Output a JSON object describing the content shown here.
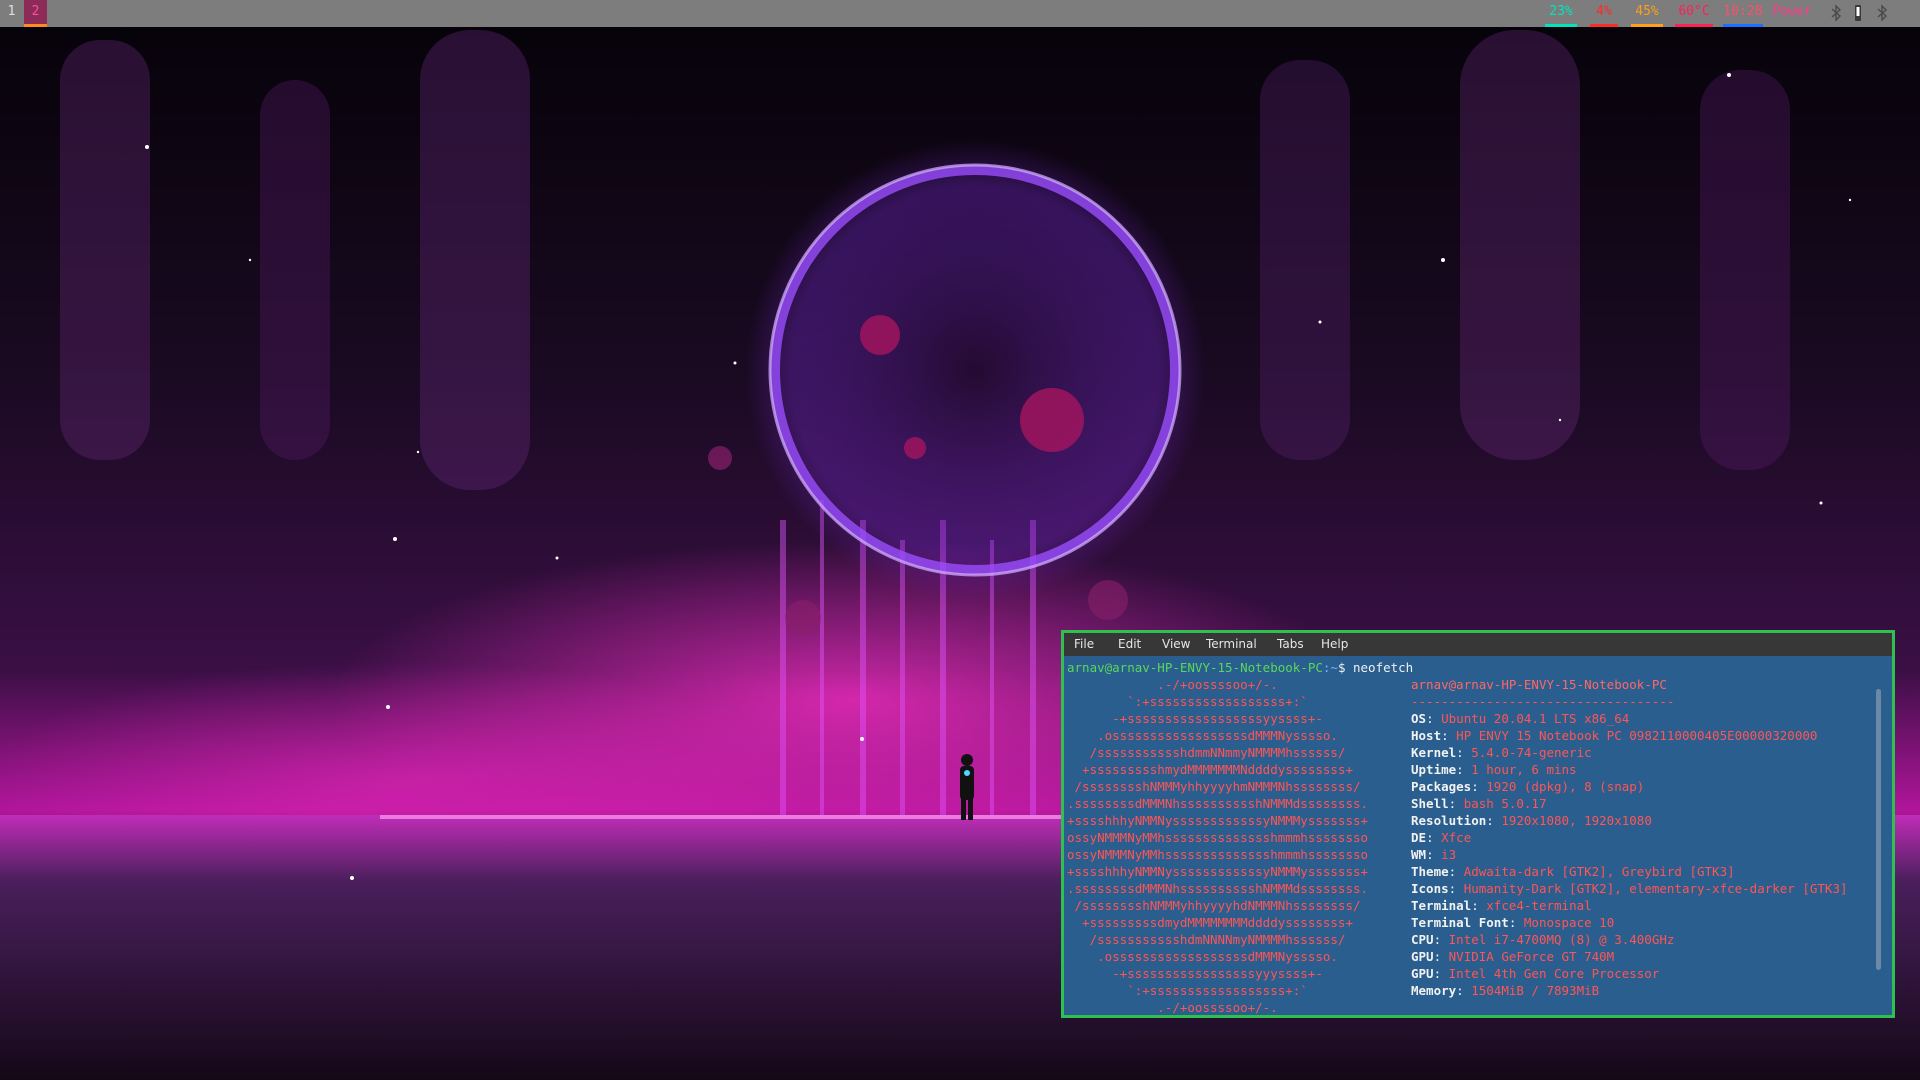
{
  "colors": {
    "topbar_bg": "#7d7d7d",
    "cpu": "#00e5c0",
    "memory": "#ff2a2a",
    "battery": "#ff9f1a",
    "temperature": "#ff1f5a",
    "clock": "#1e6fff",
    "power": "#ff3b8a",
    "terminal_border": "#2fc14f",
    "terminal_bg": "#2a5e8f",
    "terminal_menubar": "#373737"
  },
  "topbar": {
    "workspaces": [
      "1",
      "2"
    ],
    "active_workspace": "2",
    "stats": {
      "cpu": "23%",
      "memory": "4%",
      "battery": "45%",
      "temperature": "60°C",
      "clock": "10:28",
      "power": "Power"
    },
    "tray_icons": [
      "bluetooth-icon",
      "usb-icon",
      "bluetooth-icon"
    ]
  },
  "terminal": {
    "menu": [
      "File",
      "Edit",
      "View",
      "Terminal",
      "Tabs",
      "Help"
    ],
    "prompt_user_host": "arnav@arnav-HP-ENVY-15-Notebook-PC",
    "prompt_path": ":~",
    "prompt_symbol": "$",
    "command": "neofetch",
    "logo_lines": [
      "            .-/+oossssoo+/-.",
      "        `:+ssssssssssssssssss+:`",
      "      -+ssssssssssssssssssyyssss+-",
      "    .ossssssssssssssssssdMMMNysssso.",
      "   /ssssssssssshdmmNNmmyNMMMMhssssss/",
      "  +ssssssssshmydMMMMMMMNddddyssssssss+",
      " /sssssssshNMMMyhhyyyyhmNMMMNhssssssss/",
      ".ssssssssdMMMNhsssssssssshNMMMdssssssss.",
      "+sssshhhyNMMNyssssssssssssyNMMMysssssss+",
      "ossyNMMMNyMMhsssssssssssssshmmmhssssssso",
      "ossyNMMMNyMMhsssssssssssssshmmmhssssssso",
      "+sssshhhyNMMNyssssssssssssyNMMMysssssss+",
      ".ssssssssdMMMNhsssssssssshNMMMdssssssss.",
      " /sssssssshNMMMyhhyyyyhdNMMMNhssssssss/",
      "  +sssssssssdmydMMMMMMMMddddyssssssss+",
      "   /ssssssssssshdmNNNNmyNMMMMhssssss/",
      "    .ossssssssssssssssssdMMMNysssso.",
      "      -+sssssssssssssssssyyyssss+-",
      "        `:+ssssssssssssssssss+:`",
      "            .-/+oossssoo+/-."
    ],
    "title_user": "arnav",
    "title_at": "@",
    "title_host": "arnav-HP-ENVY-15-Notebook-PC",
    "separator": "-----------------------------------",
    "info": [
      {
        "key": "OS",
        "value": "Ubuntu 20.04.1 LTS x86_64"
      },
      {
        "key": "Host",
        "value": "HP ENVY 15 Notebook PC 0982110000405E00000320000"
      },
      {
        "key": "Kernel",
        "value": "5.4.0-74-generic"
      },
      {
        "key": "Uptime",
        "value": "1 hour, 6 mins"
      },
      {
        "key": "Packages",
        "value": "1920 (dpkg), 8 (snap)"
      },
      {
        "key": "Shell",
        "value": "bash 5.0.17"
      },
      {
        "key": "Resolution",
        "value": "1920x1080, 1920x1080"
      },
      {
        "key": "DE",
        "value": "Xfce"
      },
      {
        "key": "WM",
        "value": "i3"
      },
      {
        "key": "Theme",
        "value": "Adwaita-dark [GTK2], Greybird [GTK3]"
      },
      {
        "key": "Icons",
        "value": "Humanity-Dark [GTK2], elementary-xfce-darker [GTK3]"
      },
      {
        "key": "Terminal",
        "value": "xfce4-terminal"
      },
      {
        "key": "Terminal Font",
        "value": "Monospace 10"
      },
      {
        "key": "CPU",
        "value": "Intel i7-4700MQ (8) @ 3.400GHz"
      },
      {
        "key": "GPU",
        "value": "NVIDIA GeForce GT 740M"
      },
      {
        "key": "GPU",
        "value": "Intel 4th Gen Core Processor"
      },
      {
        "key": "Memory",
        "value": "1504MiB / 7893MiB"
      }
    ]
  }
}
